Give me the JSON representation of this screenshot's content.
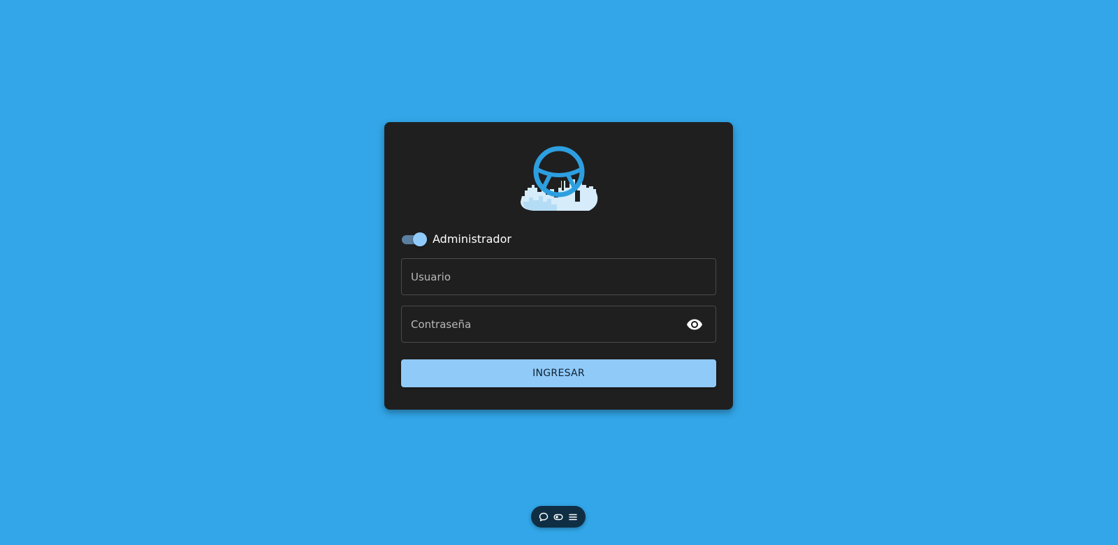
{
  "colors": {
    "background": "#32a6e8",
    "card": "#1f1f1f",
    "accent": "#90caf9",
    "logo_blue": "#2d9fe0",
    "logo_city": "#d6ecfb"
  },
  "login": {
    "logo_icon": "steering-wheel-city-logo",
    "toggle": {
      "label": "Administrador",
      "checked": true
    },
    "username": {
      "placeholder": "Usuario",
      "value": ""
    },
    "password": {
      "placeholder": "Contraseña",
      "value": "",
      "visibility_icon": "eye-icon"
    },
    "submit_label": "INGRESAR"
  },
  "floating_toolbar": {
    "buttons": [
      {
        "icon": "chat-bubble-icon"
      },
      {
        "icon": "toggle-icon"
      },
      {
        "icon": "menu-icon"
      }
    ]
  }
}
